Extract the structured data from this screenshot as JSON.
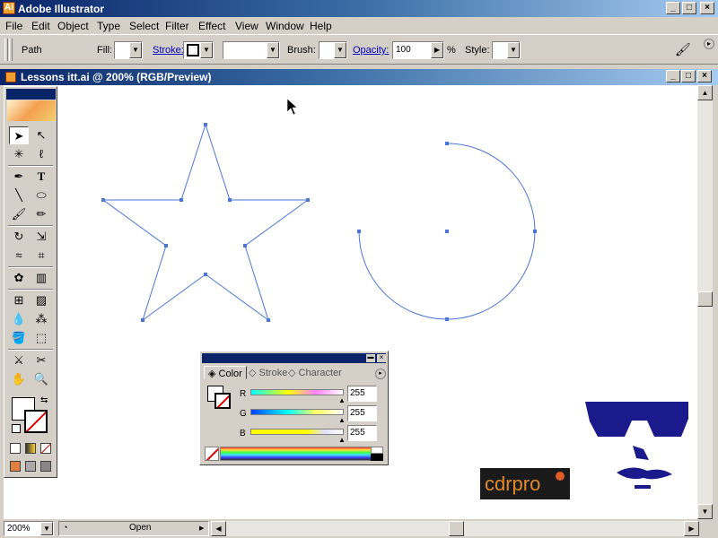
{
  "app": {
    "title": "Adobe Illustrator",
    "icon": "illustrator-app-icon"
  },
  "menu": [
    "File",
    "Edit",
    "Object",
    "Type",
    "Select",
    "Filter",
    "Effect",
    "View",
    "Window",
    "Help"
  ],
  "control_bar": {
    "object_type": "Path",
    "fill_label": "Fill:",
    "stroke_label": "Stroke:",
    "brush_label": "Brush:",
    "opacity_label": "Opacity:",
    "opacity_value": "100",
    "percent": "%",
    "style_label": "Style:"
  },
  "document": {
    "title": "Lessons itt.ai @ 200% (RGB/Preview)"
  },
  "status": {
    "zoom": "200%",
    "info": "Open"
  },
  "color_panel": {
    "tabs": [
      "Color",
      "Stroke",
      "Character"
    ],
    "channels": [
      {
        "label": "R",
        "value": "255"
      },
      {
        "label": "G",
        "value": "255"
      },
      {
        "label": "B",
        "value": "255"
      }
    ]
  },
  "watermark": {
    "text": "cdrpro"
  },
  "colors": {
    "path_stroke": "#4a76d9",
    "title_start": "#0a246a",
    "title_end": "#a6caf0",
    "mascot": "#1a1a8c"
  }
}
